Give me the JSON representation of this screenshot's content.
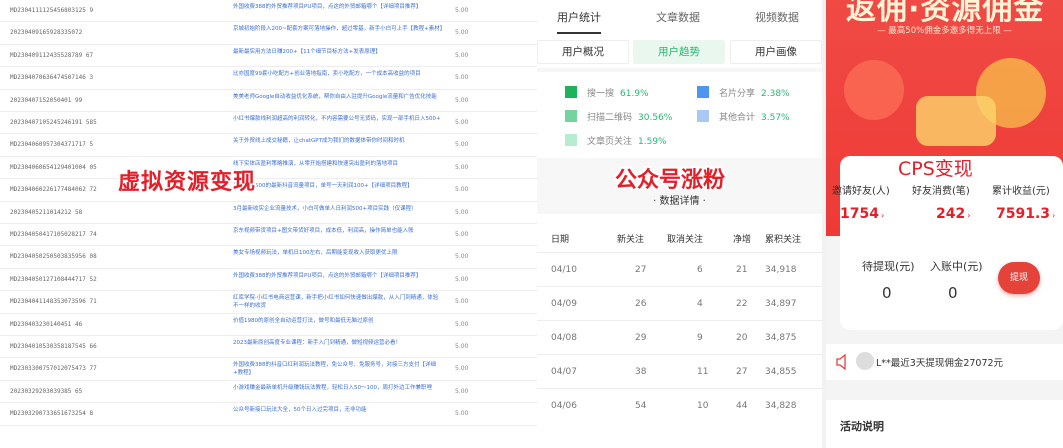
{
  "orders": {
    "rows": [
      {
        "id": "MD2304111125456803125 9",
        "title": "外国收费388的外贸推荐项目PU项目，点这的外贸邮箱哪个【详细项目推荐】",
        "price": "5.00"
      },
      {
        "id": "20230409165928335072",
        "title": "京城初始阶段入200~配套方案可落地操作，超过零基，新手小白可上手【教程+素材】",
        "price": "5.00"
      },
      {
        "id": "MD230409112435528789 67",
        "title": "最新最实用方法日赚200+【11个细节目标方法+发表原理】",
        "price": "5.00"
      },
      {
        "id": "MD2304070636474507146 3",
        "title": "比亦国度99套小吃配方+创业落地指南，卖小吃配方，一个成本高收益的项目",
        "price": "5.00"
      },
      {
        "id": "20230407152050401 99",
        "title": "美美老师Google自动收益优化系统，帮你自由入驻提升Google流量和广告优化技能",
        "price": "5.00"
      },
      {
        "id": "20230407105245246191 585",
        "title": "小红书爆款线利润超高的利润转化，不内容需要公号无货码，实现一部手机日入500+",
        "price": "5.00"
      },
      {
        "id": "MD2304060957304371717 5",
        "title": "关于外贸线上成交秘籍，让chatGPT成为我们的数据体带你时间和时机",
        "price": "5.00"
      },
      {
        "id": "MD2304060654129401004 05",
        "title": "线下实体店盈利策略推演，从零开始搭建和快速突出盈利的落地项目",
        "price": "5.00"
      },
      {
        "id": "MD2304060226177484062 72",
        "title": "外国收费500的最新抖音流量项目，单号一天利润100+【详细项目教程】",
        "price": "5.00"
      },
      {
        "id": "20230405211014212 58",
        "title": "3月最新收实企业流量技术，小白可做单人日利润500+项目实践（仅课程）",
        "price": "5.00"
      },
      {
        "id": "MD2304050417105028217 74",
        "title": "京东视频带货项目+图文带货好项目，成本低，利润高，操作简单也能入账",
        "price": "5.00"
      },
      {
        "id": "MD2304050250503835956 08",
        "title": "美女专场视频玩法，单机日100左右，后期能变现收入获取更优上限",
        "price": "5.00"
      },
      {
        "id": "MD2304050127108444717 52",
        "title": "外国收费388的外贸推荐项目PU项目，点这的外贸邮箱哪个【详细项目推荐】",
        "price": "5.00"
      },
      {
        "id": "MD2304041148353073596 71",
        "title": "红库学院·小红书电商运营课，新手把小红书如何快速做出爆款，从入门到精通，体验不一样的收货",
        "price": "5.00"
      },
      {
        "id": "MD230403230140451 46",
        "title": "价值1980的原创全自动运营打法，做号和最低无脑过原创",
        "price": "5.00"
      },
      {
        "id": "MD2304010530358187545 66",
        "title": "2023最新原创高度专业课程：新手入门到精通，做短视频运营必看！",
        "price": "5.00"
      },
      {
        "id": "MD2303300757012075473 77",
        "title": "外国收费388的抖音口红利润玩法教程，免公众号、免服务号，对接三方支付【详细+教程】",
        "price": "5.00"
      },
      {
        "id": "20230329203039385 65",
        "title": "小游戏赚金最新单机升级赚钱玩法教程，轻松日入50～100，周打外边工作兼职哩",
        "price": "5.00"
      },
      {
        "id": "MD2303290733651673254 8",
        "title": "公众号新接口玩法大全，50个日入过完项目，无非功能",
        "price": "5.00"
      }
    ],
    "overlay_text": "虚拟资源变现"
  },
  "stats": {
    "tabs": [
      "用户统计",
      "文章数据",
      "视频数据"
    ],
    "subtabs": [
      "用户概况",
      "用户趋势",
      "用户画像"
    ],
    "legend": [
      {
        "label": "搜一搜",
        "pct": "61.9%",
        "color": "#1fb25a"
      },
      {
        "label": "名片分享",
        "pct": "2.38%",
        "color": "#4f95f0"
      },
      {
        "label": "扫描二维码",
        "pct": "30.56%",
        "color": "#76d39b"
      },
      {
        "label": "其他合计",
        "pct": "3.57%",
        "color": "#a9c9f4"
      },
      {
        "label": "文章页关注",
        "pct": "1.59%",
        "color": "#b7ecd0"
      }
    ],
    "overlay_text": "公众号涨粉",
    "detail_title": "· 数据详情 ·",
    "table": {
      "headers": [
        "日期",
        "新关注",
        "取消关注",
        "净增",
        "累积关注"
      ],
      "rows": [
        [
          "04/10",
          "27",
          "6",
          "21",
          "34,918"
        ],
        [
          "04/09",
          "26",
          "4",
          "22",
          "34,897"
        ],
        [
          "04/08",
          "29",
          "9",
          "20",
          "34,875"
        ],
        [
          "04/07",
          "38",
          "11",
          "27",
          "34,855"
        ],
        [
          "04/06",
          "54",
          "10",
          "44",
          "34,828"
        ]
      ]
    }
  },
  "cps": {
    "banner_title": "返佣·资源佣金",
    "banner_sub": "— 最高50%佣金多邀多得无上限 —",
    "overlay_text": "CPS变现",
    "stats": [
      {
        "label": "邀请好友(人)",
        "value": "1754"
      },
      {
        "label": "好友消费(笔)",
        "value": "242"
      },
      {
        "label": "累计收益(元)",
        "value": "7591.3"
      }
    ],
    "balances": [
      {
        "label": "待提现(元)",
        "value": "0"
      },
      {
        "label": "入账中(元)",
        "value": "0"
      }
    ],
    "withdraw_label": "提现",
    "notice": "L**最近3天提现佣金27072元",
    "activity_title": "活动说明",
    "colors": {
      "brand_red": "#e5423a",
      "accent_green": "#2bb673"
    }
  }
}
